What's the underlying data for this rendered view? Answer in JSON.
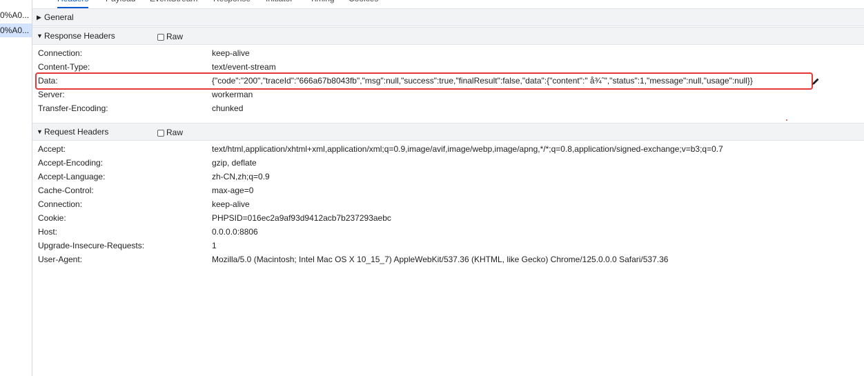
{
  "request_list": [
    {
      "name": "0%A0..."
    },
    {
      "name": "0%A0..."
    }
  ],
  "tabs": [
    {
      "label": "Headers",
      "active": true
    },
    {
      "label": "Payload"
    },
    {
      "label": "EventStream"
    },
    {
      "label": "Response"
    },
    {
      "label": "Initiator"
    },
    {
      "label": "Timing"
    },
    {
      "label": "Cookies"
    }
  ],
  "general": {
    "title": "General"
  },
  "response_headers": {
    "title": "Response Headers",
    "raw_label": "Raw",
    "rows": [
      {
        "name": "Connection:",
        "value": "keep-alive"
      },
      {
        "name": "Content-Type:",
        "value": "text/event-stream"
      },
      {
        "name": "Data:",
        "value": "{\"code\":\"200\",\"traceId\":\"666a67b8043fb\",\"msg\":null,\"success\":true,\"finalResult\":false,\"data\":{\"content\":\" å¾ˆ\",\"status\":1,\"message\":null,\"usage\":null}}"
      },
      {
        "name": "Server:",
        "value": "workerman"
      },
      {
        "name": "Transfer-Encoding:",
        "value": "chunked"
      }
    ]
  },
  "request_headers": {
    "title": "Request Headers",
    "raw_label": "Raw",
    "rows": [
      {
        "name": "Accept:",
        "value": "text/html,application/xhtml+xml,application/xml;q=0.9,image/avif,image/webp,image/apng,*/*;q=0.8,application/signed-exchange;v=b3;q=0.7"
      },
      {
        "name": "Accept-Encoding:",
        "value": "gzip, deflate"
      },
      {
        "name": "Accept-Language:",
        "value": "zh-CN,zh;q=0.9"
      },
      {
        "name": "Cache-Control:",
        "value": "max-age=0"
      },
      {
        "name": "Connection:",
        "value": "keep-alive"
      },
      {
        "name": "Cookie:",
        "value": "PHPSID=016ec2a9af93d9412acb7b237293aebc"
      },
      {
        "name": "Host:",
        "value": "0.0.0.0:8806"
      },
      {
        "name": "Upgrade-Insecure-Requests:",
        "value": "1"
      },
      {
        "name": "User-Agent:",
        "value": "Mozilla/5.0 (Macintosh; Intel Mac OS X 10_15_7) AppleWebKit/537.36 (KHTML, like Gecko) Chrome/125.0.0.0 Safari/537.36"
      }
    ]
  },
  "colors": {
    "active_tab": "#0b57d0",
    "highlight": "#e53935",
    "selected_row": "#d3e3fd",
    "section_bg": "#f1f3f4"
  }
}
